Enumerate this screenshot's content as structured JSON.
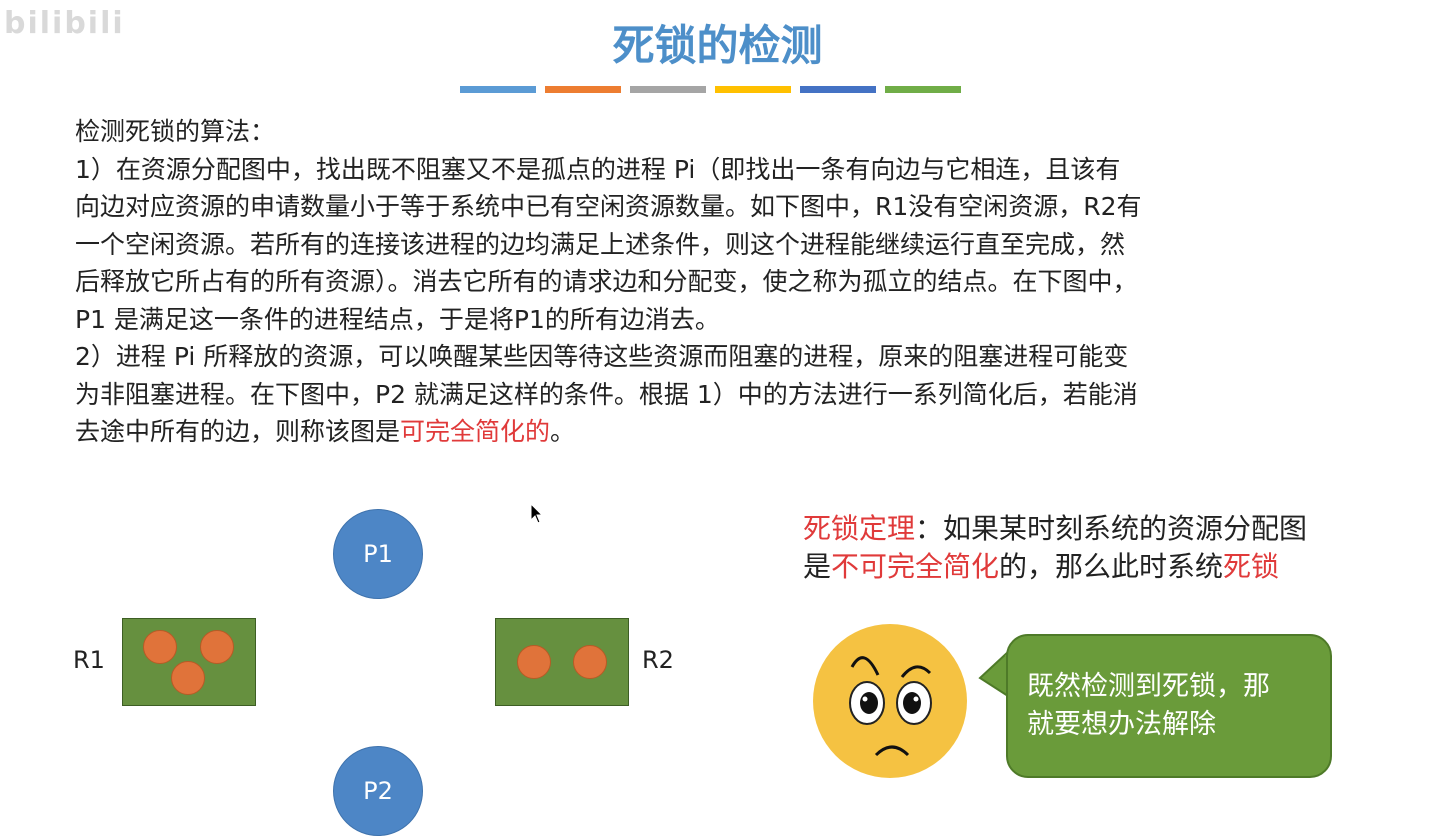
{
  "watermark": "bilibili",
  "title": "死锁的检测",
  "colors": {
    "title": "#4d8fc9",
    "bars": [
      "#5b9bd5",
      "#ed7d31",
      "#a5a5a5",
      "#ffc000",
      "#4472c4",
      "#70ad47"
    ],
    "highlight": "#e03a3a",
    "process": "#4d86c6",
    "resource": "#66903f",
    "instance": "#e0733a",
    "bubble": "#6a9b3a",
    "face": "#f5c242"
  },
  "content": {
    "heading": "检测死锁的算法：",
    "line1": "1）在资源分配图中，找出既不阻塞又不是孤点的进程 Pi（即找出一条有向边与它相连，且该有",
    "line2": "向边对应资源的申请数量小于等于系统中已有空闲资源数量。如下图中，R1没有空闲资源，R2有",
    "line3": "一个空闲资源。若所有的连接该进程的边均满足上述条件，则这个进程能继续运行直至完成，然",
    "line4": "后释放它所占有的所有资源）。消去它所有的请求边和分配变，使之称为孤立的结点。在下图中，",
    "line5": "P1 是满足这一条件的进程结点，于是将P1的所有边消去。",
    "line6": "2）进程 Pi 所释放的资源，可以唤醒某些因等待这些资源而阻塞的进程，原来的阻塞进程可能变",
    "line7": "为非阻塞进程。在下图中，P2 就满足这样的条件。根据 1）中的方法进行一系列简化后，若能消",
    "line8_a": "去途中所有的边，则称该图是",
    "line8_red": "可完全简化的",
    "line8_b": "。"
  },
  "graph": {
    "p1": "P1",
    "p2": "P2",
    "r1": "R1",
    "r2": "R2",
    "r1_instances": 3,
    "r2_instances": 2
  },
  "theorem": {
    "label": "死锁定理",
    "text1": "：如果某时刻系统的资源分配图",
    "text2_a": "是",
    "text2_red": "不可完全简化",
    "text2_b": "的，那么此时系统",
    "text2_red2": "死锁"
  },
  "bubble": {
    "line1": "既然检测到死锁，那",
    "line2": "就要想办法解除"
  }
}
